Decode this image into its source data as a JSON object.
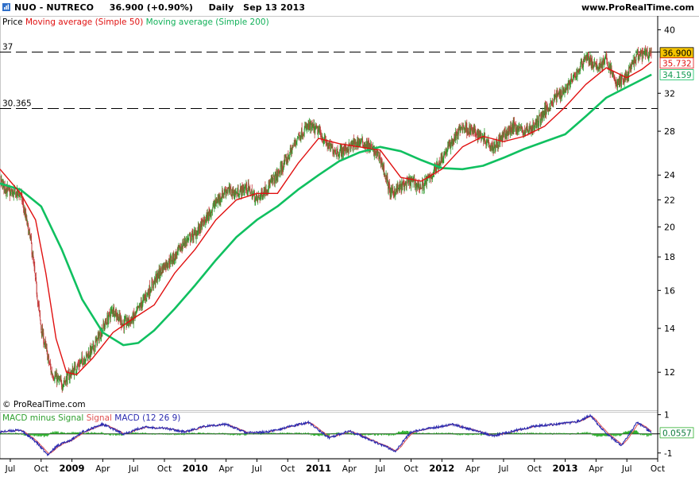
{
  "header": {
    "title": "NUO - NUTRECO",
    "price": "36.900 (+0.90%)",
    "period": "Daily",
    "date": "Sep 13 2013",
    "site": "www.ProRealTime.com"
  },
  "legend": {
    "price": "Price",
    "ma50": "Moving average (Simple 50)",
    "ma200": "Moving average (Simple 200)"
  },
  "macd_legend": {
    "hist": "MACD minus Signal",
    "signal": "Signal",
    "macd": "MACD (12 26 9)"
  },
  "copyright": "© ProRealTime.com",
  "colors": {
    "candle_up": "#2e9a2e",
    "candle_down": "#c43c3c",
    "ma50": "#e01010",
    "ma200": "#10c060",
    "macd": "#2b2bb0",
    "signal": "#e05050",
    "hist": "#30b030",
    "last_price_bg": "#f5c400"
  },
  "chart_data": {
    "type": "candlestick",
    "scale": "log",
    "price_axis": {
      "ticks": [
        "40",
        "37",
        "32",
        "28",
        "24",
        "22",
        "20",
        "18",
        "16",
        "14",
        "12"
      ],
      "tick_values": [
        40,
        37,
        32,
        28,
        24,
        22,
        20,
        18,
        16,
        14,
        12
      ],
      "range": [
        10.5,
        42
      ]
    },
    "x_axis": {
      "labels": [
        "Jul",
        "Oct",
        "2009",
        "Apr",
        "Jul",
        "Oct",
        "2010",
        "Apr",
        "Jul",
        "Oct",
        "2011",
        "Apr",
        "Jul",
        "Oct",
        "2012",
        "Apr",
        "Jul",
        "Oct",
        "2013",
        "Apr",
        "Jul",
        "Oct"
      ],
      "bold_labels": [
        "2009",
        "2010",
        "2011",
        "2012",
        "2013"
      ],
      "start": "2008-06",
      "end": "2013-10"
    },
    "horizontal_lines": [
      {
        "label": "37",
        "value": 37,
        "style": "dashed"
      },
      {
        "label": "30.365",
        "value": 30.365,
        "style": "dashed"
      }
    ],
    "price_keypoints": [
      [
        "2008-05-01",
        25.0
      ],
      [
        "2008-06-01",
        23.5
      ],
      [
        "2008-07-01",
        22.5
      ],
      [
        "2008-08-01",
        22.5
      ],
      [
        "2008-09-01",
        19.0
      ],
      [
        "2008-10-01",
        14.0
      ],
      [
        "2008-11-01",
        12.0
      ],
      [
        "2008-12-01",
        11.5
      ],
      [
        "2009-01-01",
        12.0
      ],
      [
        "2009-02-01",
        12.5
      ],
      [
        "2009-03-01",
        13.0
      ],
      [
        "2009-04-01",
        14.0
      ],
      [
        "2009-05-01",
        15.0
      ],
      [
        "2009-06-01",
        14.2
      ],
      [
        "2009-07-01",
        14.5
      ],
      [
        "2009-08-01",
        15.5
      ],
      [
        "2009-09-01",
        16.5
      ],
      [
        "2009-10-01",
        17.5
      ],
      [
        "2009-11-01",
        18.0
      ],
      [
        "2009-12-01",
        19.0
      ],
      [
        "2010-01-01",
        19.5
      ],
      [
        "2010-02-01",
        20.5
      ],
      [
        "2010-03-01",
        21.8
      ],
      [
        "2010-04-01",
        22.8
      ],
      [
        "2010-05-01",
        22.5
      ],
      [
        "2010-06-01",
        23.0
      ],
      [
        "2010-07-01",
        22.0
      ],
      [
        "2010-08-01",
        23.0
      ],
      [
        "2010-09-01",
        24.0
      ],
      [
        "2010-10-01",
        25.5
      ],
      [
        "2010-11-01",
        27.5
      ],
      [
        "2010-12-01",
        28.5
      ],
      [
        "2011-01-01",
        28.0
      ],
      [
        "2011-02-01",
        26.5
      ],
      [
        "2011-03-01",
        26.0
      ],
      [
        "2011-04-01",
        26.5
      ],
      [
        "2011-05-01",
        27.0
      ],
      [
        "2011-06-01",
        26.5
      ],
      [
        "2011-07-01",
        25.5
      ],
      [
        "2011-08-01",
        22.5
      ],
      [
        "2011-09-01",
        23.0
      ],
      [
        "2011-10-01",
        23.5
      ],
      [
        "2011-11-01",
        23.0
      ],
      [
        "2011-12-01",
        24.0
      ],
      [
        "2012-01-01",
        25.5
      ],
      [
        "2012-02-01",
        27.0
      ],
      [
        "2012-03-01",
        28.5
      ],
      [
        "2012-04-01",
        28.0
      ],
      [
        "2012-05-01",
        27.5
      ],
      [
        "2012-06-01",
        26.5
      ],
      [
        "2012-07-01",
        27.5
      ],
      [
        "2012-08-01",
        28.5
      ],
      [
        "2012-09-01",
        28.0
      ],
      [
        "2012-10-01",
        28.5
      ],
      [
        "2012-11-01",
        30.0
      ],
      [
        "2012-12-01",
        31.5
      ],
      [
        "2013-01-01",
        32.5
      ],
      [
        "2013-02-01",
        34.0
      ],
      [
        "2013-03-01",
        36.5
      ],
      [
        "2013-04-01",
        35.0
      ],
      [
        "2013-05-01",
        36.0
      ],
      [
        "2013-06-01",
        33.0
      ],
      [
        "2013-07-01",
        34.0
      ],
      [
        "2013-08-01",
        36.5
      ],
      [
        "2013-09-13",
        36.9
      ]
    ],
    "ma50_keypoints": [
      [
        "2008-06-01",
        24.5
      ],
      [
        "2008-08-01",
        22.5
      ],
      [
        "2008-09-15",
        20.5
      ],
      [
        "2008-10-15",
        17.0
      ],
      [
        "2008-11-15",
        13.5
      ],
      [
        "2008-12-15",
        12.0
      ],
      [
        "2009-01-15",
        11.9
      ],
      [
        "2009-03-01",
        12.6
      ],
      [
        "2009-05-01",
        13.8
      ],
      [
        "2009-07-01",
        14.5
      ],
      [
        "2009-09-01",
        15.2
      ],
      [
        "2009-11-01",
        17.0
      ],
      [
        "2010-01-01",
        18.5
      ],
      [
        "2010-03-01",
        20.5
      ],
      [
        "2010-05-01",
        22.0
      ],
      [
        "2010-07-01",
        22.5
      ],
      [
        "2010-09-01",
        22.5
      ],
      [
        "2010-11-01",
        25.0
      ],
      [
        "2011-01-01",
        27.3
      ],
      [
        "2011-03-01",
        26.8
      ],
      [
        "2011-05-01",
        26.5
      ],
      [
        "2011-07-01",
        26.2
      ],
      [
        "2011-09-01",
        23.8
      ],
      [
        "2011-11-01",
        23.5
      ],
      [
        "2012-01-01",
        24.5
      ],
      [
        "2012-03-01",
        26.5
      ],
      [
        "2012-05-01",
        27.5
      ],
      [
        "2012-07-01",
        27.0
      ],
      [
        "2012-09-01",
        27.5
      ],
      [
        "2012-11-01",
        28.5
      ],
      [
        "2013-01-01",
        30.5
      ],
      [
        "2013-03-01",
        33.0
      ],
      [
        "2013-05-01",
        35.0
      ],
      [
        "2013-07-01",
        33.8
      ],
      [
        "2013-08-15",
        34.8
      ],
      [
        "2013-09-13",
        35.732
      ]
    ],
    "ma200_keypoints": [
      [
        "2008-06-01",
        23.3
      ],
      [
        "2008-08-01",
        22.8
      ],
      [
        "2008-10-01",
        21.5
      ],
      [
        "2008-12-01",
        18.5
      ],
      [
        "2009-02-01",
        15.5
      ],
      [
        "2009-04-01",
        13.8
      ],
      [
        "2009-06-01",
        13.2
      ],
      [
        "2009-07-15",
        13.3
      ],
      [
        "2009-09-01",
        13.9
      ],
      [
        "2009-11-01",
        15.0
      ],
      [
        "2010-01-01",
        16.3
      ],
      [
        "2010-03-01",
        17.8
      ],
      [
        "2010-05-01",
        19.3
      ],
      [
        "2010-07-01",
        20.5
      ],
      [
        "2010-09-01",
        21.5
      ],
      [
        "2010-11-01",
        22.8
      ],
      [
        "2011-01-01",
        24.0
      ],
      [
        "2011-03-01",
        25.2
      ],
      [
        "2011-05-01",
        26.0
      ],
      [
        "2011-07-01",
        26.5
      ],
      [
        "2011-09-01",
        26.1
      ],
      [
        "2011-11-01",
        25.3
      ],
      [
        "2012-01-01",
        24.6
      ],
      [
        "2012-03-01",
        24.5
      ],
      [
        "2012-05-01",
        24.8
      ],
      [
        "2012-07-01",
        25.5
      ],
      [
        "2012-09-01",
        26.3
      ],
      [
        "2012-11-01",
        27.0
      ],
      [
        "2013-01-01",
        27.7
      ],
      [
        "2013-03-01",
        29.5
      ],
      [
        "2013-05-01",
        31.5
      ],
      [
        "2013-07-01",
        32.7
      ],
      [
        "2013-09-13",
        34.159
      ]
    ],
    "last_values": {
      "price": "36.900",
      "ma50": "35.732",
      "ma200": "34.159"
    },
    "macd": {
      "axis_ticks": [
        "1",
        "0",
        "-1"
      ],
      "tick_values": [
        1,
        0,
        -1
      ],
      "range": [
        -1.3,
        1.15
      ],
      "last_value": "0.0557",
      "macd_keypoints": [
        [
          "2008-06-01",
          0.1
        ],
        [
          "2008-08-01",
          0.2
        ],
        [
          "2008-09-15",
          -0.4
        ],
        [
          "2008-10-20",
          -1.1
        ],
        [
          "2008-11-20",
          -0.6
        ],
        [
          "2009-01-01",
          -0.3
        ],
        [
          "2009-02-01",
          0.1
        ],
        [
          "2009-04-01",
          0.5
        ],
        [
          "2009-06-01",
          0.0
        ],
        [
          "2009-08-01",
          0.35
        ],
        [
          "2009-10-01",
          0.3
        ],
        [
          "2009-12-01",
          0.1
        ],
        [
          "2010-02-01",
          0.4
        ],
        [
          "2010-04-01",
          0.5
        ],
        [
          "2010-06-01",
          0.05
        ],
        [
          "2010-08-01",
          0.1
        ],
        [
          "2010-10-01",
          0.35
        ],
        [
          "2010-12-01",
          0.6
        ],
        [
          "2011-02-01",
          -0.2
        ],
        [
          "2011-04-01",
          0.15
        ],
        [
          "2011-06-01",
          -0.3
        ],
        [
          "2011-08-15",
          -0.9
        ],
        [
          "2011-10-01",
          0.1
        ],
        [
          "2011-12-01",
          0.3
        ],
        [
          "2012-02-01",
          0.5
        ],
        [
          "2012-04-01",
          0.2
        ],
        [
          "2012-06-01",
          -0.1
        ],
        [
          "2012-08-01",
          0.15
        ],
        [
          "2012-10-01",
          0.4
        ],
        [
          "2012-12-01",
          0.5
        ],
        [
          "2013-02-01",
          0.6
        ],
        [
          "2013-03-15",
          0.95
        ],
        [
          "2013-05-01",
          0.0
        ],
        [
          "2013-06-15",
          -0.6
        ],
        [
          "2013-08-01",
          0.6
        ],
        [
          "2013-09-13",
          0.0557
        ]
      ]
    }
  }
}
